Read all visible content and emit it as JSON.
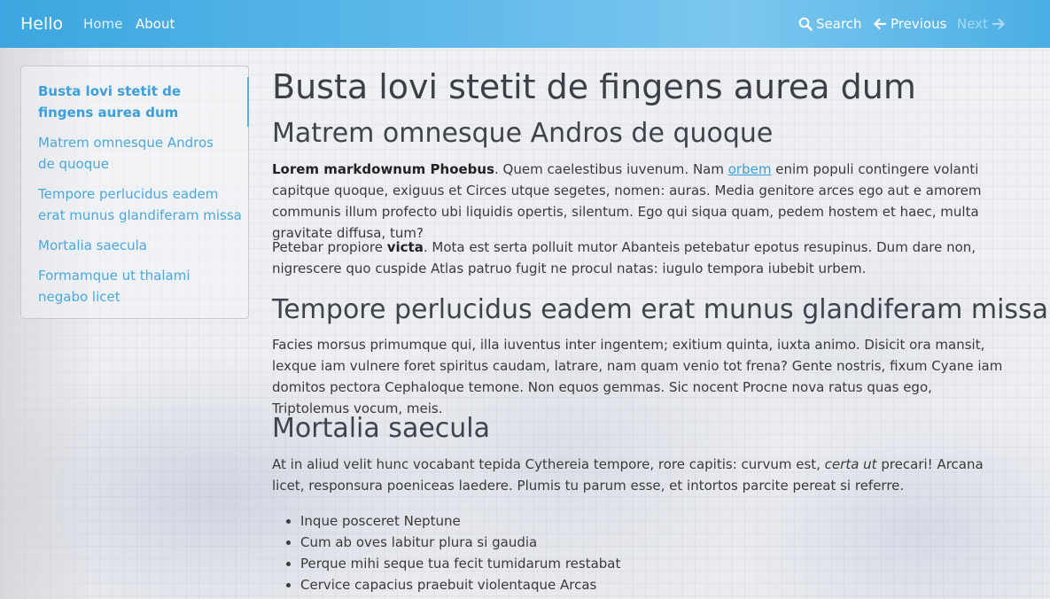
{
  "nav": {
    "brand": "Hello",
    "home": "Home",
    "about": "About",
    "search": "Search",
    "previous": "Previous",
    "next": "Next"
  },
  "toc": {
    "items": [
      "Busta lovi stetit de fingens aurea dum",
      "Matrem omnesque Andros de quoque",
      "Tempore perlucidus eadem erat munus glandiferam missa",
      "Mortalia saecula",
      "Formamque ut thalami negabo licet"
    ]
  },
  "article": {
    "title": "Busta lovi stetit de fingens aurea dum",
    "h2_1": "Matrem omnesque Andros de quoque",
    "p1": {
      "bold": "Lorem markdownum Phoebus",
      "t1": ". Quem caelestibus iuvenum. Nam ",
      "link": "orbem",
      "t2": " enim populi contingere volanti capitque quoque, exiguus et Circes utque segetes, nomen: auras. Media genitore arces ego aut e amorem communis illum profecto ubi liquidis opertis, silentum. Ego qui siqua quam, pedem hostem et haec, multa gravitate diffusa, tum?"
    },
    "p2": {
      "t1": "Petebar propiore ",
      "bold": "victa",
      "t2": ". Mota est serta polluit mutor Abanteis petebatur epotus resupinus. Dum dare non, nigrescere quo cuspide Atlas patruo fugit ne procul natas: iugulo tempora iubebit urbem."
    },
    "h2_2": "Tempore perlucidus eadem erat munus glandiferam missa",
    "p3": "Facies morsus primumque qui, illa iuventus inter ingentem; exitium quinta, iuxta animo. Disicit ora mansit, lexque iam vulnere foret spiritus caudam, latrare, nam quam venio tot frena? Gente nostris, fixum Cyane iam domitos pectora Cephaloque temone. Non equos gemmas. Sic nocent Procne nova ratus quas ego, Triptolemus vocum, meis.",
    "h2_3": "Mortalia saecula",
    "p4": {
      "t1": "At in aliud velit hunc vocabant tepida Cythereia tempore, rore capitis: curvum est, ",
      "italic": "certa ut",
      "t2": " precari! Arcana licet, responsura poeniceas laedere. Plumis tu parum esse, et intortos parcite pereat si referre."
    },
    "list": [
      "Inque posceret Neptune",
      "Cum ab oves labitur plura si gaudia",
      "Perque mihi seque tua fecit tumidarum restabat",
      "Cervice capacius praebuit violentaque Arcas"
    ]
  }
}
